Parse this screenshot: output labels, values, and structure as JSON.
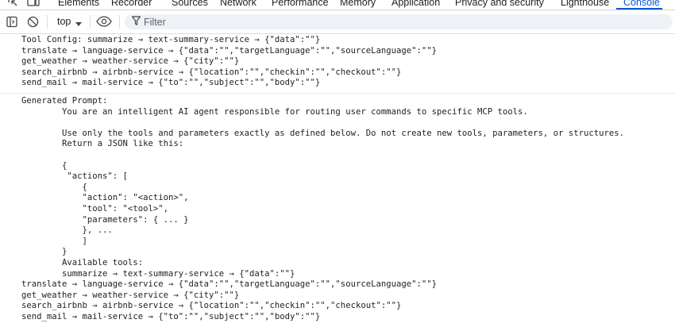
{
  "devtools": {
    "tabs": [
      {
        "label": "Elements",
        "active": false
      },
      {
        "label": "Recorder",
        "active": false
      },
      {
        "label": "Sources",
        "active": false
      },
      {
        "label": "Network",
        "active": false
      },
      {
        "label": "Performance",
        "active": false
      },
      {
        "label": "Memory",
        "active": false
      },
      {
        "label": "Application",
        "active": false
      },
      {
        "label": "Privacy and security",
        "active": false
      },
      {
        "label": "Lighthouse",
        "active": false
      },
      {
        "label": "Console",
        "active": true
      }
    ],
    "accent_color": "#0b57d0"
  },
  "toolbar": {
    "context": "top",
    "filter_placeholder": "Filter"
  },
  "console": {
    "messages": [
      {
        "lines": [
          "Tool Config: summarize → text-summary-service → {\"data\":\"\"}",
          "translate → language-service → {\"data\":\"\",\"targetLanguage\":\"\",\"sourceLanguage\":\"\"}",
          "get_weather → weather-service → {\"city\":\"\"}",
          "search_airbnb → airbnb-service → {\"location\":\"\",\"checkin\":\"\",\"checkout\":\"\"}",
          "send_mail → mail-service → {\"to\":\"\",\"subject\":\"\",\"body\":\"\"}"
        ]
      },
      {
        "lines": [
          "Generated Prompt:",
          "        You are an intelligent AI agent responsible for routing user commands to specific MCP tools.",
          "",
          "        Use only the tools and parameters exactly as defined below. Do not create new tools, parameters, or structures.",
          "        Return a JSON like this:",
          "",
          "        {",
          "         \"actions\": [",
          "            {",
          "            \"action\": \"<action>\",",
          "            \"tool\": \"<tool>\",",
          "            \"parameters\": { ... }",
          "            }, ...",
          "            ]",
          "        }",
          "        Available tools:",
          "        summarize → text-summary-service → {\"data\":\"\"}",
          "translate → language-service → {\"data\":\"\",\"targetLanguage\":\"\",\"sourceLanguage\":\"\"}",
          "get_weather → weather-service → {\"city\":\"\"}",
          "search_airbnb → airbnb-service → {\"location\":\"\",\"checkin\":\"\",\"checkout\":\"\"}",
          "send_mail → mail-service → {\"to\":\"\",\"subject\":\"\",\"body\":\"\"}"
        ]
      }
    ]
  }
}
